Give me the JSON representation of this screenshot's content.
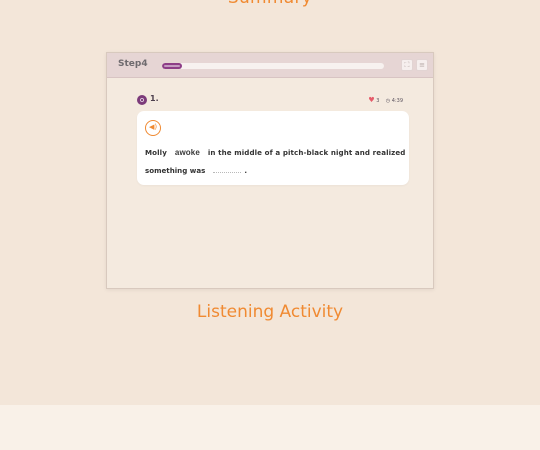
{
  "top_title": "Summary",
  "caption": "Listening Activity",
  "header": {
    "step_label": "Step4",
    "progress_fraction": 0.09,
    "buttons": [
      {
        "name": "fullscreen-button",
        "icon": "fullscreen-icon",
        "glyph": "⛶"
      },
      {
        "name": "menu-button",
        "icon": "menu-icon",
        "glyph": "≡"
      }
    ]
  },
  "question": {
    "number_icon": "o",
    "number": "1.",
    "likes": "3",
    "timer": "4:39"
  },
  "card": {
    "speaker_glyph": "◀)",
    "line1_start": "Molly",
    "highlight_word": "awoke",
    "line1_end": "in the middle of a pitch-black night and realized",
    "line2_start": "something was",
    "line2_end": "."
  }
}
